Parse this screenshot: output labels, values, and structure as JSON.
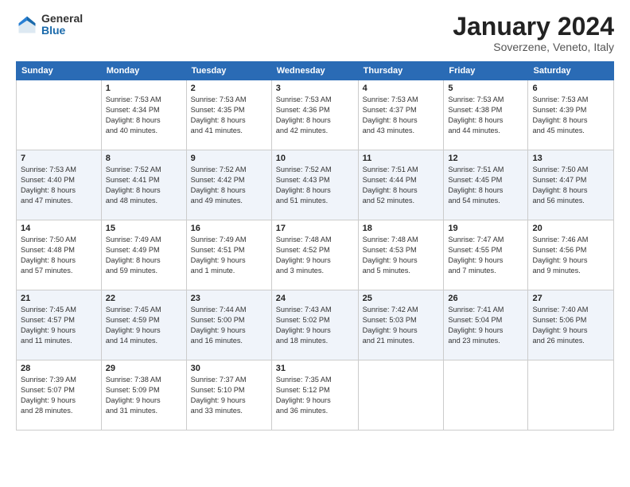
{
  "header": {
    "logo_general": "General",
    "logo_blue": "Blue",
    "month_title": "January 2024",
    "location": "Soverzene, Veneto, Italy"
  },
  "days_of_week": [
    "Sunday",
    "Monday",
    "Tuesday",
    "Wednesday",
    "Thursday",
    "Friday",
    "Saturday"
  ],
  "weeks": [
    [
      {
        "day": "",
        "info": ""
      },
      {
        "day": "1",
        "info": "Sunrise: 7:53 AM\nSunset: 4:34 PM\nDaylight: 8 hours\nand 40 minutes."
      },
      {
        "day": "2",
        "info": "Sunrise: 7:53 AM\nSunset: 4:35 PM\nDaylight: 8 hours\nand 41 minutes."
      },
      {
        "day": "3",
        "info": "Sunrise: 7:53 AM\nSunset: 4:36 PM\nDaylight: 8 hours\nand 42 minutes."
      },
      {
        "day": "4",
        "info": "Sunrise: 7:53 AM\nSunset: 4:37 PM\nDaylight: 8 hours\nand 43 minutes."
      },
      {
        "day": "5",
        "info": "Sunrise: 7:53 AM\nSunset: 4:38 PM\nDaylight: 8 hours\nand 44 minutes."
      },
      {
        "day": "6",
        "info": "Sunrise: 7:53 AM\nSunset: 4:39 PM\nDaylight: 8 hours\nand 45 minutes."
      }
    ],
    [
      {
        "day": "7",
        "info": "Sunrise: 7:53 AM\nSunset: 4:40 PM\nDaylight: 8 hours\nand 47 minutes."
      },
      {
        "day": "8",
        "info": "Sunrise: 7:52 AM\nSunset: 4:41 PM\nDaylight: 8 hours\nand 48 minutes."
      },
      {
        "day": "9",
        "info": "Sunrise: 7:52 AM\nSunset: 4:42 PM\nDaylight: 8 hours\nand 49 minutes."
      },
      {
        "day": "10",
        "info": "Sunrise: 7:52 AM\nSunset: 4:43 PM\nDaylight: 8 hours\nand 51 minutes."
      },
      {
        "day": "11",
        "info": "Sunrise: 7:51 AM\nSunset: 4:44 PM\nDaylight: 8 hours\nand 52 minutes."
      },
      {
        "day": "12",
        "info": "Sunrise: 7:51 AM\nSunset: 4:45 PM\nDaylight: 8 hours\nand 54 minutes."
      },
      {
        "day": "13",
        "info": "Sunrise: 7:50 AM\nSunset: 4:47 PM\nDaylight: 8 hours\nand 56 minutes."
      }
    ],
    [
      {
        "day": "14",
        "info": "Sunrise: 7:50 AM\nSunset: 4:48 PM\nDaylight: 8 hours\nand 57 minutes."
      },
      {
        "day": "15",
        "info": "Sunrise: 7:49 AM\nSunset: 4:49 PM\nDaylight: 8 hours\nand 59 minutes."
      },
      {
        "day": "16",
        "info": "Sunrise: 7:49 AM\nSunset: 4:51 PM\nDaylight: 9 hours\nand 1 minute."
      },
      {
        "day": "17",
        "info": "Sunrise: 7:48 AM\nSunset: 4:52 PM\nDaylight: 9 hours\nand 3 minutes."
      },
      {
        "day": "18",
        "info": "Sunrise: 7:48 AM\nSunset: 4:53 PM\nDaylight: 9 hours\nand 5 minutes."
      },
      {
        "day": "19",
        "info": "Sunrise: 7:47 AM\nSunset: 4:55 PM\nDaylight: 9 hours\nand 7 minutes."
      },
      {
        "day": "20",
        "info": "Sunrise: 7:46 AM\nSunset: 4:56 PM\nDaylight: 9 hours\nand 9 minutes."
      }
    ],
    [
      {
        "day": "21",
        "info": "Sunrise: 7:45 AM\nSunset: 4:57 PM\nDaylight: 9 hours\nand 11 minutes."
      },
      {
        "day": "22",
        "info": "Sunrise: 7:45 AM\nSunset: 4:59 PM\nDaylight: 9 hours\nand 14 minutes."
      },
      {
        "day": "23",
        "info": "Sunrise: 7:44 AM\nSunset: 5:00 PM\nDaylight: 9 hours\nand 16 minutes."
      },
      {
        "day": "24",
        "info": "Sunrise: 7:43 AM\nSunset: 5:02 PM\nDaylight: 9 hours\nand 18 minutes."
      },
      {
        "day": "25",
        "info": "Sunrise: 7:42 AM\nSunset: 5:03 PM\nDaylight: 9 hours\nand 21 minutes."
      },
      {
        "day": "26",
        "info": "Sunrise: 7:41 AM\nSunset: 5:04 PM\nDaylight: 9 hours\nand 23 minutes."
      },
      {
        "day": "27",
        "info": "Sunrise: 7:40 AM\nSunset: 5:06 PM\nDaylight: 9 hours\nand 26 minutes."
      }
    ],
    [
      {
        "day": "28",
        "info": "Sunrise: 7:39 AM\nSunset: 5:07 PM\nDaylight: 9 hours\nand 28 minutes."
      },
      {
        "day": "29",
        "info": "Sunrise: 7:38 AM\nSunset: 5:09 PM\nDaylight: 9 hours\nand 31 minutes."
      },
      {
        "day": "30",
        "info": "Sunrise: 7:37 AM\nSunset: 5:10 PM\nDaylight: 9 hours\nand 33 minutes."
      },
      {
        "day": "31",
        "info": "Sunrise: 7:35 AM\nSunset: 5:12 PM\nDaylight: 9 hours\nand 36 minutes."
      },
      {
        "day": "",
        "info": ""
      },
      {
        "day": "",
        "info": ""
      },
      {
        "day": "",
        "info": ""
      }
    ]
  ]
}
